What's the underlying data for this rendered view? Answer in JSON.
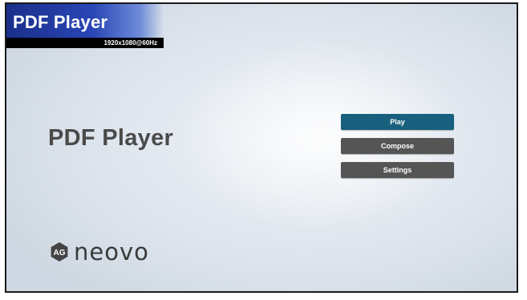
{
  "header": {
    "app_title": "PDF Player",
    "resolution": "1920x1080@60Hz"
  },
  "main": {
    "title": "PDF Player"
  },
  "menu": {
    "items": [
      {
        "label": "Play",
        "active": true
      },
      {
        "label": "Compose",
        "active": false
      },
      {
        "label": "Settings",
        "active": false
      }
    ]
  },
  "branding": {
    "logo_mark": "AG",
    "logo_text": "neovo"
  },
  "colors": {
    "active_button": "#18607d",
    "inactive_button": "#555555",
    "title_band": "#2a46b6"
  }
}
